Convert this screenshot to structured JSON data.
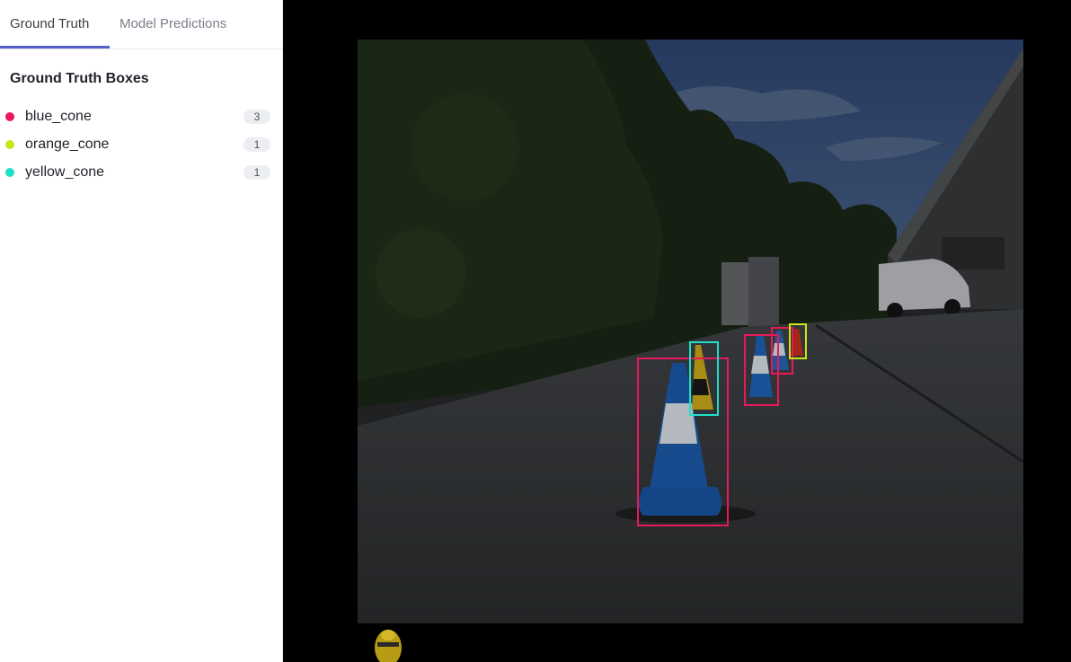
{
  "tabs": {
    "ground_truth": "Ground Truth",
    "model_predictions": "Model Predictions",
    "active": "ground_truth"
  },
  "panel": {
    "title": "Ground Truth Boxes",
    "classes": [
      {
        "label": "blue_cone",
        "count": "3",
        "color": "#e8195a"
      },
      {
        "label": "orange_cone",
        "count": "1",
        "color": "#c8e61a"
      },
      {
        "label": "yellow_cone",
        "count": "1",
        "color": "#1ee0c8"
      }
    ]
  },
  "viewer": {
    "background": "#000000",
    "image_description_hidden": true
  }
}
